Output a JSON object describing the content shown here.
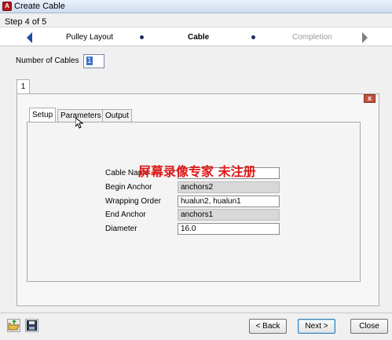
{
  "window": {
    "title": "Create Cable",
    "app_icon": "app-icon"
  },
  "step_label": "Step 4 of 5",
  "wizard": {
    "steps": [
      {
        "label": "Pulley Layout",
        "state": "done"
      },
      {
        "label": "Cable",
        "state": "active"
      },
      {
        "label": "Completion",
        "state": "future"
      }
    ]
  },
  "num_cables": {
    "label": "Number of Cables",
    "value": "1"
  },
  "cable_tabs": [
    {
      "label": "1"
    }
  ],
  "inner_tabs": [
    {
      "label": "Setup",
      "selected": true
    },
    {
      "label": "Parameters",
      "selected": false
    },
    {
      "label": "Output",
      "selected": false
    }
  ],
  "setup_fields": [
    {
      "label": "Cable Name",
      "value": "",
      "readonly": false
    },
    {
      "label": "Begin Anchor",
      "value": "anchors2",
      "readonly": true
    },
    {
      "label": "Wrapping Order",
      "value": "hualun2, hualun1",
      "readonly": false
    },
    {
      "label": "End Anchor",
      "value": "anchors1",
      "readonly": true
    },
    {
      "label": "Diameter",
      "value": "16.0",
      "readonly": false
    }
  ],
  "watermark": "屏幕录像专家  未注册",
  "close_glyph": "x",
  "buttons": {
    "back": "< Back",
    "next": "Next >",
    "close": "Close"
  },
  "colors": {
    "accent": "#1d4f9c",
    "watermark": "#e01818",
    "readonly_bg": "#d8d8d8"
  }
}
